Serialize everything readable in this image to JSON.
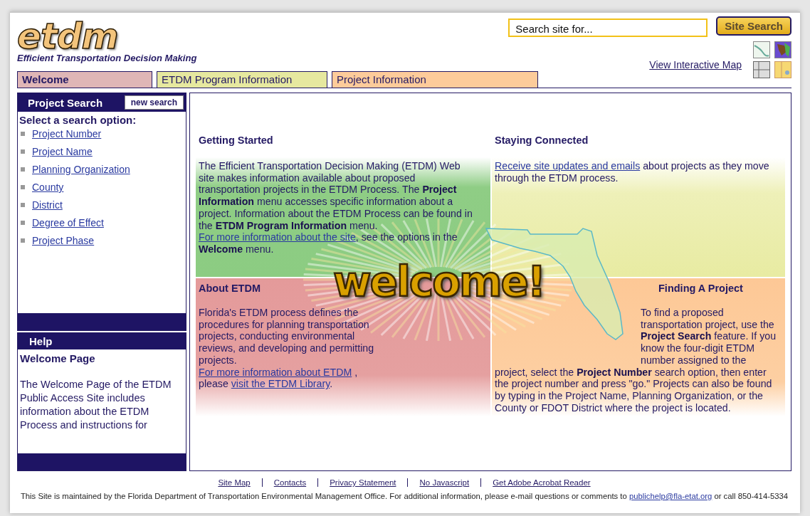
{
  "header": {
    "logo": "etdm",
    "tagline": "Efficient Transportation Decision Making",
    "search": {
      "placeholder": "Search site for..."
    },
    "search_button": "Site Search",
    "map_link": "View Interactive Map"
  },
  "tabs": [
    {
      "label": "Welcome",
      "selected": true,
      "color": "#dfb6b6"
    },
    {
      "label": "ETDM Program Information",
      "selected": false,
      "color": "#e6e89f"
    },
    {
      "label": "Project Information",
      "selected": false,
      "color": "#fdcb9a"
    }
  ],
  "sidebar": {
    "title": "Project Search",
    "new_search": "new search",
    "prompt": "Select a search option:",
    "items": [
      "Project Number",
      "Project Name",
      "Planning Organization",
      "County",
      "District",
      "Degree of Effect",
      "Project Phase"
    ],
    "help": {
      "title": "Help",
      "heading": "Welcome Page",
      "text": "The Welcome Page of the ETDM Public Access Site includes information about the ETDM Process and instructions for"
    }
  },
  "content": {
    "banner": "welcome!",
    "sections": [
      {
        "title": "Getting Started",
        "paragraph": [
          {
            "kind": "text",
            "text": "The Efficient Transportation Decision Making (ETDM) Web site makes information available about proposed transportation projects in the ETDM Process. The **Project Information** menu accesses specific information about a project. Information about the ETDM Process can be found in the **ETDM Program Information** menu. "
          },
          {
            "kind": "link",
            "text": "For more information about the site"
          },
          {
            "kind": "text",
            "text": ", see the options in the **Welcome** menu."
          }
        ]
      },
      {
        "title": "Staying Connected",
        "paragraph": [
          {
            "kind": "link",
            "text": "Receive site updates and emails"
          },
          {
            "kind": "text",
            "text": " about projects as they move through the ETDM process."
          }
        ]
      },
      {
        "title": "About ETDM",
        "paragraph": [
          {
            "kind": "text",
            "text": "Florida's ETDM process defines the procedures for planning transportation projects, conducting environmental reviews, and developing and permitting projects. "
          },
          {
            "kind": "link",
            "text": "For more information about ETDM"
          },
          {
            "kind": "text",
            "text": " , please "
          },
          {
            "kind": "link",
            "text": "visit the ETDM Library"
          },
          {
            "kind": "text",
            "text": "."
          }
        ]
      },
      {
        "title": "Finding A Project",
        "paragraph": [
          {
            "kind": "text",
            "text": "To find a proposed transportation project, use the **Project Search** feature. If you know the four-digit ETDM number assigned to the project, select the **Project Number** search option, then enter the project number and press \"go.\" Projects can also be found by typing in the Project Name, Planning Organization, or the County or FDOT District where the project is located."
          }
        ]
      }
    ]
  },
  "footer": {
    "links": [
      "Site Map",
      "Contacts",
      "Privacy Statement",
      "No Javascript",
      "Get Adobe Acrobat Reader"
    ],
    "notice": [
      {
        "kind": "text",
        "text": "This Site is maintained by the Florida Department of Transportation Environmental Management Office. For additional information, please e-mail questions or comments to "
      },
      {
        "kind": "link",
        "text": "publichelp@fla-etat.org"
      },
      {
        "kind": "text",
        "text": " or call 850-414-5334"
      }
    ]
  }
}
